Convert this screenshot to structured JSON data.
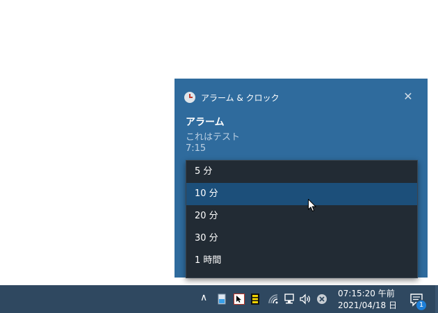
{
  "toast": {
    "app_name": "アラーム & クロック",
    "title": "アラーム",
    "body": "これはテスト",
    "time": "7:15",
    "close_glyph": "✕"
  },
  "snooze_options": [
    "5 分",
    "10 分",
    "20 分",
    "30 分",
    "1 時間"
  ],
  "selected_option": "10 分",
  "taskbar": {
    "clock_time": "07:15:20 午前",
    "clock_date": "2021/04/18 日",
    "tray_chevron": "∧",
    "notification_count": "1"
  },
  "colors": {
    "toast_bg": "#2f6b9d",
    "dropdown_bg": "#222b34",
    "selected_bg": "#1c4f7a",
    "taskbar_bg": "#2f4860"
  }
}
